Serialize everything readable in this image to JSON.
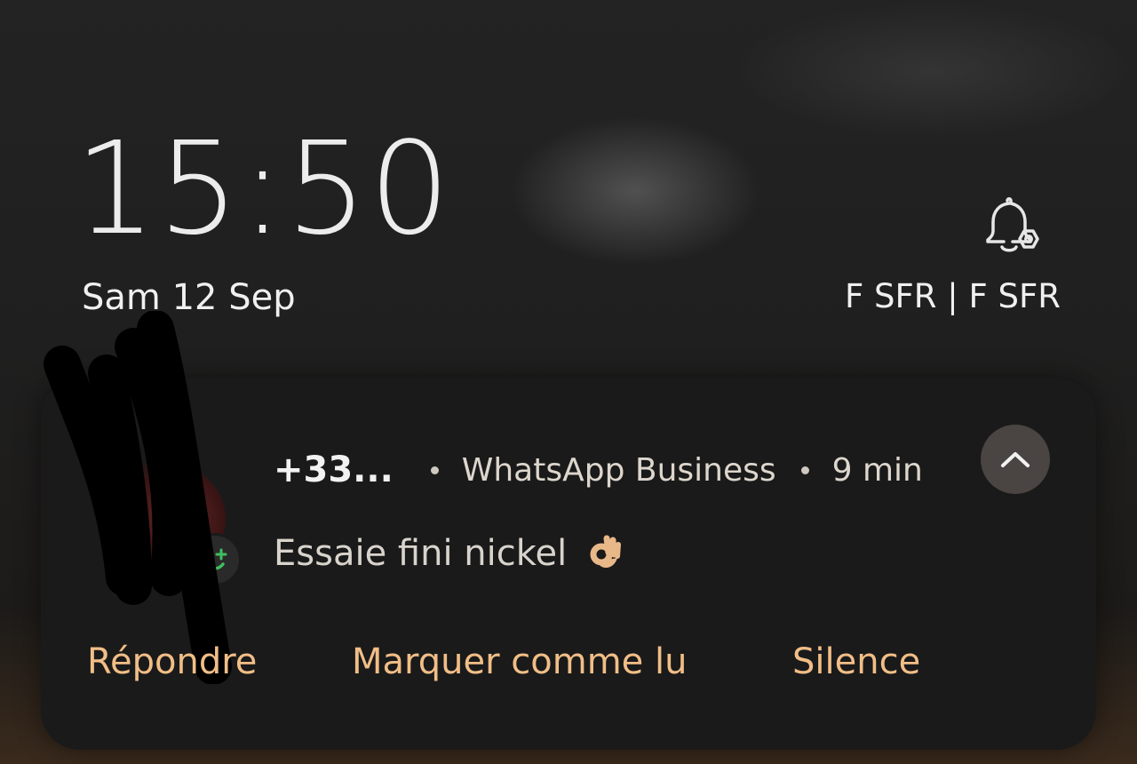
{
  "lockscreen": {
    "time": "15:50",
    "date": "Sam 12 Sep",
    "carrier": "F SFR | F SFR"
  },
  "notification": {
    "sender": "+33...",
    "app": "WhatsApp Business",
    "age": "9 min",
    "message": "Essaie fini nickel",
    "actions": {
      "reply": "Répondre",
      "mark_read": "Marquer comme lu",
      "silence": "Silence"
    }
  },
  "colors": {
    "action_text": "#f1be87",
    "card_bg": "#1a1a1a"
  },
  "icons": {
    "bell": "bell-settings-icon",
    "collapse": "chevron-up-icon",
    "emoji": "ok-hand-emoji",
    "badge": "whatsapp-business-badge-icon"
  }
}
